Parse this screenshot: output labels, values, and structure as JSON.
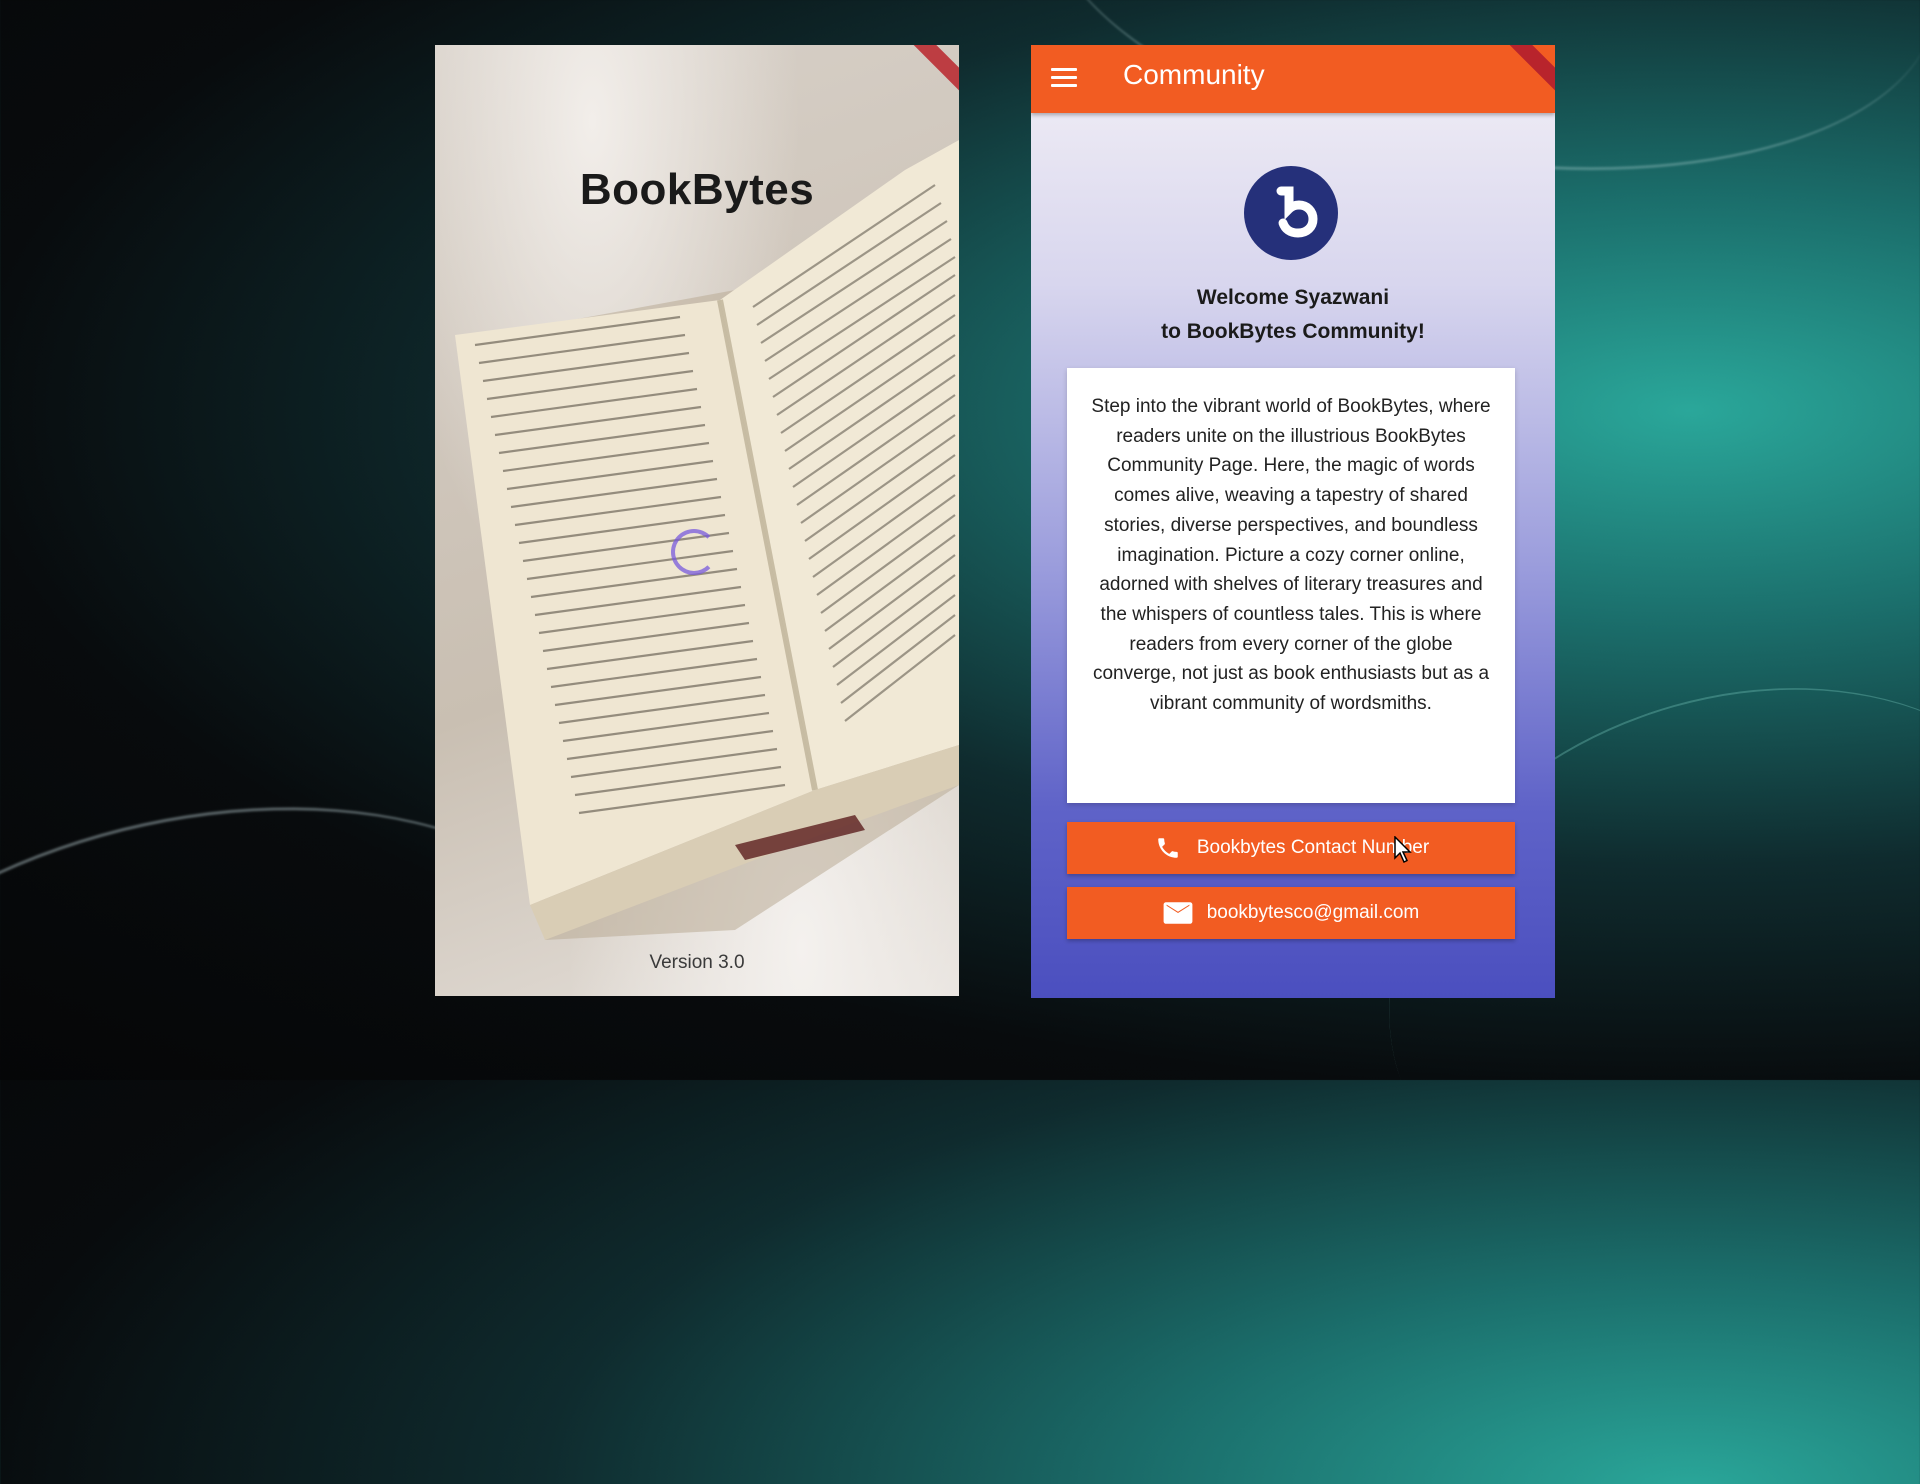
{
  "splash": {
    "title": "BookBytes",
    "version": "Version 3.0"
  },
  "community": {
    "appbar_title": "Community",
    "welcome_line1": "Welcome Syazwani",
    "welcome_line2": "to BookBytes Community!",
    "description": "Step into the vibrant world of BookBytes, where readers unite on the illustrious BookBytes Community Page. Here, the magic of words comes alive, weaving a tapestry of shared stories, diverse perspectives, and boundless imagination. Picture a cozy corner online, adorned with shelves of literary treasures and the whispers of countless tales. This is where readers from every corner of the globe converge, not just as book enthusiasts but as a vibrant community of wordsmiths.",
    "contact_button": "Bookbytes Contact Number",
    "email_button": "bookbytesco@gmail.com"
  },
  "icons": [
    "menu-icon",
    "logo-icon",
    "phone-icon",
    "mail-icon",
    "spinner-icon",
    "cursor-icon"
  ],
  "colors": {
    "accent": "#f25c22",
    "logo": "#25307a",
    "gradient_bottom": "#4b4fbf"
  }
}
